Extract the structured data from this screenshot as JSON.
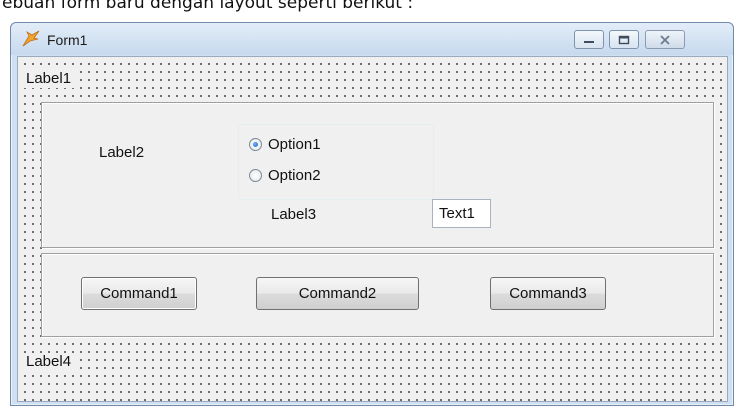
{
  "caption": "ebuah form baru dengan layout seperti berikut :",
  "window": {
    "title": "Form1",
    "icon": "vb-form-icon",
    "controls": [
      "minimize-icon",
      "maximize-icon",
      "close-icon"
    ]
  },
  "form": {
    "label1": "Label1",
    "label2": "Label2",
    "label3": "Label3",
    "label4": "Label4",
    "options": [
      {
        "label": "Option1",
        "checked": true
      },
      {
        "label": "Option2",
        "checked": false
      }
    ],
    "text1": "Text1",
    "commands": [
      "Command1",
      "Command2",
      "Command3"
    ]
  },
  "colors": {
    "accent": "#1b5ec4",
    "form_background": "#f0f0f0",
    "titlebar": "#c6d9ee"
  }
}
